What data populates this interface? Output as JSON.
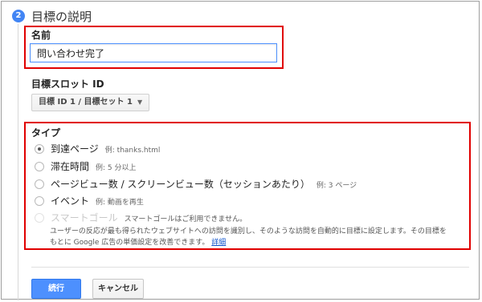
{
  "step": {
    "number": "2",
    "title": "目標の説明"
  },
  "name_field": {
    "label": "名前",
    "value": "問い合わせ完了"
  },
  "slot": {
    "label": "目標スロット ID",
    "dropdown_value": "目標 ID 1 / 目標セット 1"
  },
  "type": {
    "label": "タイプ",
    "options": [
      {
        "label": "到達ページ",
        "example": "例: thanks.html",
        "checked": true
      },
      {
        "label": "滞在時間",
        "example": "例: 5 分以上",
        "checked": false
      },
      {
        "label": "ページビュー数 / スクリーンビュー数（セッションあたり）",
        "example": "例: 3 ページ",
        "checked": false
      },
      {
        "label": "イベント",
        "example": "例: 動画を再生",
        "checked": false
      },
      {
        "label": "スマートゴール",
        "note": "スマートゴールはご利用できません。",
        "disabled": true
      }
    ],
    "description_line1": "ユーザーの反応が最も得られたウェブサイトへの訪問を識別し、そのような訪問を自動的に目標に設定します。その目標を",
    "description_line2": "もとに Google 広告の単価設定を改善できます。",
    "details_link": "詳細"
  },
  "buttons": {
    "continue": "続行",
    "cancel": "キャンセル"
  },
  "colors": {
    "accent": "#4285f4",
    "highlight_box": "#e00000",
    "link": "#1155cc"
  }
}
